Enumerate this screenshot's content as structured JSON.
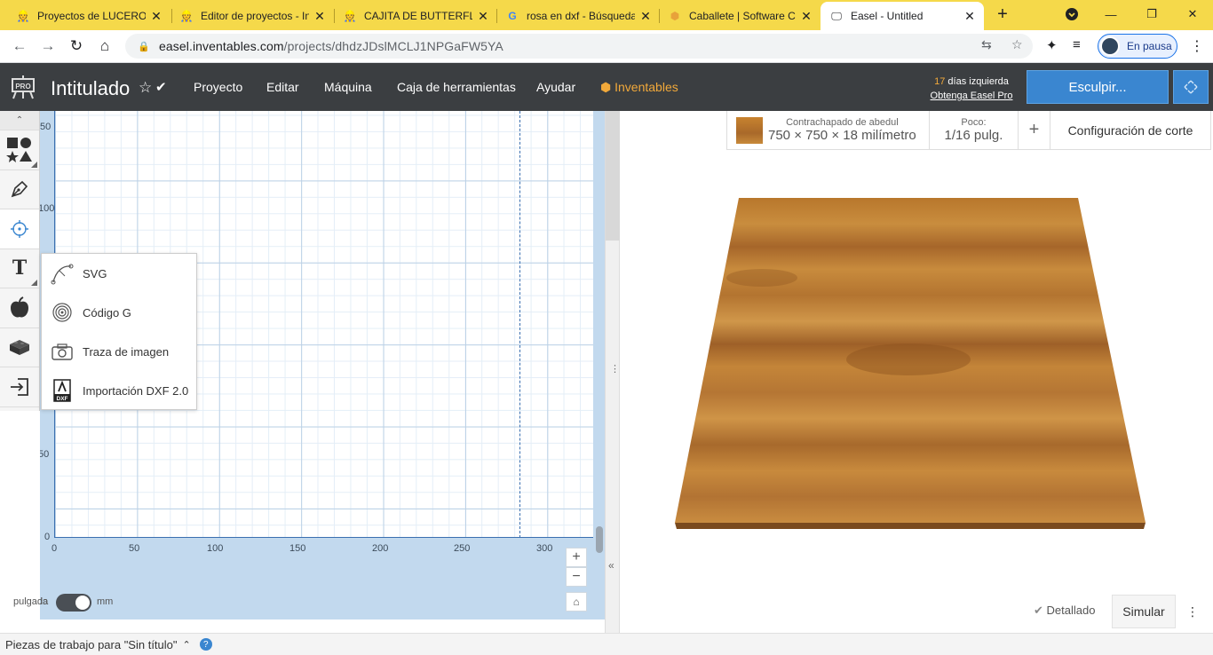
{
  "browser": {
    "tabs": [
      {
        "title": "Proyectos de LUCERO",
        "icon": "easel-icon"
      },
      {
        "title": "Editor de proyectos - In",
        "icon": "easel-icon"
      },
      {
        "title": "CAJITA DE BUTTERFLY",
        "icon": "easel-icon"
      },
      {
        "title": "rosa en dxf - Búsqueda",
        "icon": "google-icon"
      },
      {
        "title": "Caballete | Software CN",
        "icon": "inventables-icon"
      },
      {
        "title": "Easel - Untitled",
        "icon": "monitor-icon",
        "active": true
      }
    ],
    "new_tab": "+",
    "url_host": "easel.inventables.com",
    "url_path": "/projects/dhdzJDslMCLJ1NPGaFW5YA",
    "profile_label": "En pausa"
  },
  "header": {
    "title": "Intitulado",
    "menu": [
      "Proyecto",
      "Editar",
      "Máquina",
      "Caja de herramientas",
      "Ayudar"
    ],
    "brand": "Inventables",
    "trial_days": "17",
    "trial_text": " días izquierda",
    "trial_link": "Obtenga Easel Pro",
    "carve_label": "Esculpir..."
  },
  "canvas": {
    "x_ticks": [
      "0",
      "50",
      "100",
      "150",
      "200",
      "250",
      "300"
    ],
    "y_ticks": [
      "50",
      "100",
      "50",
      "0"
    ],
    "zoom_in": "+",
    "zoom_out": "−",
    "unit_left": "pulgada",
    "unit_right": "mm"
  },
  "import_menu": {
    "items": [
      {
        "label": "SVG",
        "icon": "svg-curve-icon"
      },
      {
        "label": "Código G",
        "icon": "gcode-spiral-icon"
      },
      {
        "label": "Traza de imagen",
        "icon": "camera-icon"
      },
      {
        "label": "Importación DXF 2.0",
        "icon": "dxf-file-icon"
      }
    ]
  },
  "material": {
    "name": "Contrachapado de abedul",
    "dims": "750 × 750 × 18 milímetro",
    "bit_label": "Poco:",
    "bit_value": "1/16 pulg.",
    "add": "+",
    "cut_settings": "Configuración de corte"
  },
  "preview": {
    "detailed": "Detallado",
    "simulate": "Simular"
  },
  "status": {
    "text": "Piezas de trabajo para \"Sin título\""
  }
}
